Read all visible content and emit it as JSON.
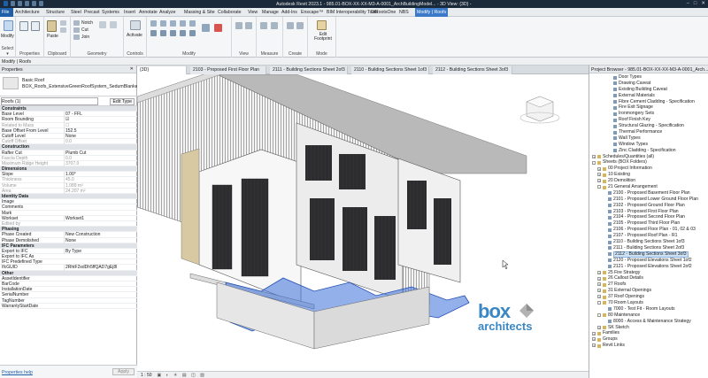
{
  "titlebar": {
    "title": "Autodesk Revit 2023.1 - 985.01-BOX-XX-XX-M3-A-0001_ArchBuildingModel...",
    "view": "- 3D View: {3D} -"
  },
  "ribbon_tabs": [
    "File",
    "Architecture",
    "Structure",
    "Steel",
    "Precast",
    "Systems",
    "Insert",
    "Annotate",
    "Analyze",
    "Massing & Site",
    "Collaborate",
    "View",
    "Manage",
    "Add-Ins",
    "Enscape™",
    "BIM Interoperability Tools",
    "DiRootsOne",
    "NBS",
    "Modify | Roofs"
  ],
  "ribbon": {
    "groups": [
      "Select",
      "Properties",
      "Clipboard",
      "Geometry",
      "Controls",
      "Modify",
      "View",
      "Measure",
      "Create",
      "Mode"
    ],
    "modify_label": "Modify",
    "select_label": "Select ▾",
    "paste_label": "Paste",
    "geometry_items": [
      "Notch",
      "Cut",
      "Join"
    ],
    "activate_label": "Activate",
    "edit_footprint_label": "Edit Footprint"
  },
  "context_bar": "Modify | Roofs",
  "properties": {
    "header": "Properties",
    "type_family": "Basic Roof",
    "type_name": "BOX_Roofs_ExtensiveGreenRoofSystem_SedumBlanket",
    "filter": "Roofs (1)",
    "edit_type": "Edit Type",
    "rows": [
      {
        "k": "Constraints",
        "sec": true
      },
      {
        "k": "Base Level",
        "v": "07 - FFL"
      },
      {
        "k": "Room Bounding",
        "v": "☑"
      },
      {
        "k": "Related to Mass",
        "v": "☐",
        "dim": true
      },
      {
        "k": "Base Offset From Level",
        "v": "152.5"
      },
      {
        "k": "Cutoff Level",
        "v": "None"
      },
      {
        "k": "Cutoff Offset",
        "v": "0.0",
        "dim": true
      },
      {
        "k": "Construction",
        "sec": true
      },
      {
        "k": "Rafter Cut",
        "v": "Plumb Cut"
      },
      {
        "k": "Fascia Depth",
        "v": "0.0",
        "dim": true
      },
      {
        "k": "Maximum Ridge Height",
        "v": "3707.0",
        "dim": true
      },
      {
        "k": "Dimensions",
        "sec": true
      },
      {
        "k": "Slope",
        "v": "1.00°"
      },
      {
        "k": "Thickness",
        "v": "45.0",
        "dim": true
      },
      {
        "k": "Volume",
        "v": "1.089 m³",
        "dim": true
      },
      {
        "k": "Area",
        "v": "24.207 m²",
        "dim": true
      },
      {
        "k": "Identity Data",
        "sec": true
      },
      {
        "k": "Image",
        "v": ""
      },
      {
        "k": "Comments",
        "v": ""
      },
      {
        "k": "Mark",
        "v": ""
      },
      {
        "k": "Workset",
        "v": "Workset1"
      },
      {
        "k": "Edited by",
        "v": "",
        "dim": true
      },
      {
        "k": "Phasing",
        "sec": true
      },
      {
        "k": "Phase Created",
        "v": "New Construction"
      },
      {
        "k": "Phase Demolished",
        "v": "None"
      },
      {
        "k": "IFC Parameters",
        "sec": true
      },
      {
        "k": "Export to IFC",
        "v": "By Type"
      },
      {
        "k": "Export to IFC As",
        "v": ""
      },
      {
        "k": "IFC Predefined Type",
        "v": ""
      },
      {
        "k": "IfcGUID",
        "v": "2RhtF2xdDh5ffQAD7gEj8l"
      },
      {
        "k": "Other",
        "sec": true
      },
      {
        "k": "AssetIdentifier",
        "v": ""
      },
      {
        "k": "BarCode",
        "v": ""
      },
      {
        "k": "InstallationDate",
        "v": ""
      },
      {
        "k": "SerialNumber",
        "v": ""
      },
      {
        "k": "TagNumber",
        "v": ""
      },
      {
        "k": "WarrantyStartDate",
        "v": ""
      }
    ],
    "help_link": "Properties help",
    "apply": "Apply"
  },
  "view_tabs": [
    "{3D}",
    "2103 - Proposed First Floor Plan",
    "2111 - Building Sections Sheet 2of3",
    "2110 - Building Sections Sheet 1of3",
    "2112 - Building Sections Sheet 3of3"
  ],
  "view_bar": {
    "scale": "1 : 50"
  },
  "logo": {
    "word1": "box",
    "word2": "architects"
  },
  "browser": {
    "header": "Project Browser - 985.01-BOX-XX-XX-M3-A-0001_Arch...",
    "items": [
      {
        "t": "Door Types",
        "d": 3
      },
      {
        "t": "Drawing Caveat",
        "d": 3
      },
      {
        "t": "Existing Building Caveat",
        "d": 3
      },
      {
        "t": "External Materials",
        "d": 3
      },
      {
        "t": "Fibre Cement Cladding - Specification",
        "d": 3
      },
      {
        "t": "Fire Exit Signage",
        "d": 3
      },
      {
        "t": "Ironmongery Sets",
        "d": 3
      },
      {
        "t": "Roof Finish Key",
        "d": 3
      },
      {
        "t": "Structural Glazing - Specification",
        "d": 3
      },
      {
        "t": "Thermal Performance",
        "d": 3
      },
      {
        "t": "Wall Types",
        "d": 3
      },
      {
        "t": "Window Types",
        "d": 3
      },
      {
        "t": "Zinc Cladding - Specification",
        "d": 3
      },
      {
        "t": "Schedules/Quantities (all)",
        "d": 0,
        "tg": "+"
      },
      {
        "t": "Sheets (BOX Folders)",
        "d": 0,
        "tg": "-"
      },
      {
        "t": "00 Project Information",
        "d": 1,
        "tg": "+"
      },
      {
        "t": "10 Existing",
        "d": 1,
        "tg": "+"
      },
      {
        "t": "20 Demolition",
        "d": 1,
        "tg": "+"
      },
      {
        "t": "21 General Arrangement",
        "d": 1,
        "tg": "-"
      },
      {
        "t": "2100 - Proposed Basement Floor Plan",
        "d": 2
      },
      {
        "t": "2101 - Proposed Lower Ground Floor Plan",
        "d": 2
      },
      {
        "t": "2102 - Proposed Ground Floor Plan",
        "d": 2
      },
      {
        "t": "2103 - Proposed First Floor Plan",
        "d": 2
      },
      {
        "t": "2104 - Proposed Second Floor Plan",
        "d": 2
      },
      {
        "t": "2105 - Proposed Third Floor Plan",
        "d": 2
      },
      {
        "t": "2106 - Proposed Floor Plan - 01, 02 & 03",
        "d": 2
      },
      {
        "t": "2107 - Proposed Roof Plan - R1",
        "d": 2
      },
      {
        "t": "2110 - Building Sections Sheet 1of3",
        "d": 2
      },
      {
        "t": "2111 - Building Sections Sheet 2of3",
        "d": 2
      },
      {
        "t": "2112 - Building Sections Sheet 3of3",
        "d": 2,
        "sel": true
      },
      {
        "t": "2120 - Proposed Elevations Sheet 1of2",
        "d": 2
      },
      {
        "t": "2121 - Proposed Elevations Sheet 2of2",
        "d": 2
      },
      {
        "t": "25 Fire Strategy",
        "d": 1,
        "tg": "+"
      },
      {
        "t": "26 Callout Details",
        "d": 1,
        "tg": "+"
      },
      {
        "t": "27 Roofs",
        "d": 1,
        "tg": "+"
      },
      {
        "t": "31 External Openings",
        "d": 1,
        "tg": "+"
      },
      {
        "t": "37 Roof Openings",
        "d": 1,
        "tg": "+"
      },
      {
        "t": "70 Room Layouts",
        "d": 1,
        "tg": "-"
      },
      {
        "t": "7000 - Test Fit - Room Layouts",
        "d": 2
      },
      {
        "t": "80 Maintenance",
        "d": 1,
        "tg": "-"
      },
      {
        "t": "8000 - Access & Maintenance Strategy",
        "d": 2
      },
      {
        "t": "SK Sketch",
        "d": 1,
        "tg": "+"
      },
      {
        "t": "Families",
        "d": 0,
        "tg": "+"
      },
      {
        "t": "Groups",
        "d": 0,
        "tg": "+"
      },
      {
        "t": "Revit Links",
        "d": 0,
        "tg": "+"
      }
    ]
  }
}
